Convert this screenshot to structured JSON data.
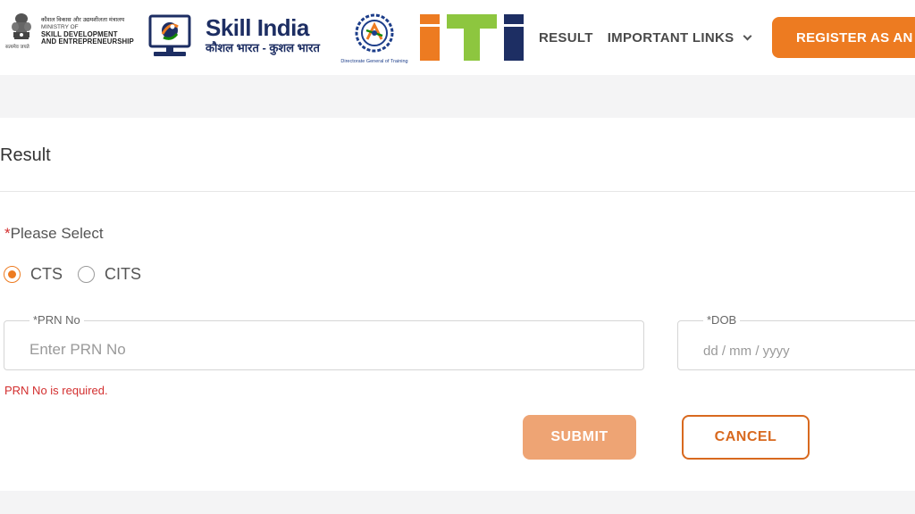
{
  "header": {
    "ministry": {
      "hindi_line": "कौशल विकास और उद्यमशीलता मंत्रालय",
      "line1": "MINISTRY OF",
      "line2": "SKILL DEVELOPMENT",
      "line3": "AND ENTREPRENEURSHIP",
      "emblem_caption": "सत्यमेव जयते"
    },
    "skill_india": {
      "title": "Skill India",
      "tagline": "कौशल भारत - कुशल भारत"
    },
    "dgt_caption": "Directorate General of Training",
    "iti_logo": "iti",
    "nav": {
      "result": "RESULT",
      "important_links": "IMPORTANT LINKS"
    },
    "register_button": "REGISTER AS AN"
  },
  "card": {
    "title": "Result",
    "select_prompt": "Please Select",
    "required_mark": "*",
    "options": [
      {
        "label": "CTS",
        "selected": true
      },
      {
        "label": "CITS",
        "selected": false
      }
    ],
    "prn": {
      "label": "*PRN No",
      "placeholder": "Enter PRN No",
      "value": ""
    },
    "dob": {
      "label": "*DOB",
      "placeholder": "dd / mm / yyyy"
    },
    "error": "PRN No is required.",
    "submit_label": "SUBMIT",
    "cancel_label": "CANCEL"
  },
  "colors": {
    "accent_orange": "#ed7b21",
    "navy": "#1d2e63",
    "error_red": "#d32f2f",
    "submit_disabled": "#eea474",
    "iti_green": "#8dc63f",
    "iti_blue": "#1d2e63"
  },
  "icons": {
    "emblem": "national-emblem-icon",
    "monitor": "monitor-logo-icon",
    "dgt": "dgt-gear-icon",
    "dropdown": "chevron-down-icon"
  }
}
